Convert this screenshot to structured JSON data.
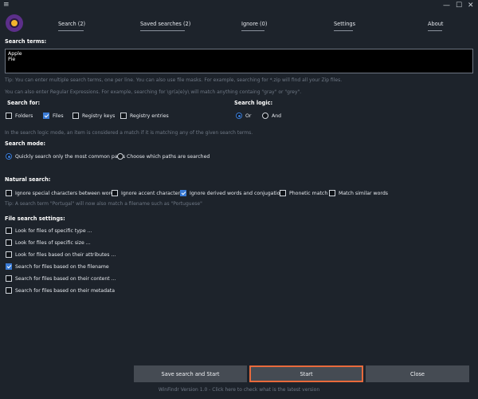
{
  "window": {
    "menu_icon": "hamburger-icon",
    "minimize": "—",
    "maximize": "☐",
    "close": "✕"
  },
  "tabs": [
    {
      "label": "Search (2)"
    },
    {
      "label": "Saved searches (2)"
    },
    {
      "label": "Ignore (0)"
    },
    {
      "label": "Settings"
    },
    {
      "label": "About"
    }
  ],
  "search_terms": {
    "label": "Search terms:",
    "value": "Apple\nPie",
    "tip1": "Tip: You can enter multiple search terms, one per line. You can also use file masks. For example, searching for *.zip will find all your Zip files.",
    "tip2": "You can also enter Regular Expressions. For example, searching for \\gr(a|e)y\\ will match anything containg \"gray\" or \"grey\"."
  },
  "search_for": {
    "label": "Search for:",
    "options": [
      {
        "label": "Folders",
        "checked": false
      },
      {
        "label": "Files",
        "checked": true
      },
      {
        "label": "Registry keys",
        "checked": false
      },
      {
        "label": "Registry entries",
        "checked": false
      }
    ]
  },
  "search_logic": {
    "label": "Search logic:",
    "options": [
      {
        "label": "Or",
        "selected": true
      },
      {
        "label": "And",
        "selected": false
      }
    ],
    "tip": "In the search logic mode, an item is considered a match if it is matching any of the given search terms."
  },
  "search_mode": {
    "label": "Search mode:",
    "options": [
      {
        "label": "Quickly search only the most common paths",
        "selected": true
      },
      {
        "label": "Choose which paths are searched",
        "selected": false
      }
    ]
  },
  "natural_search": {
    "label": "Natural search:",
    "options": [
      {
        "label": "Ignore special characters between words",
        "checked": false
      },
      {
        "label": "Ignore accent characters",
        "checked": false
      },
      {
        "label": "Ignore derived words and conjugations",
        "checked": true
      },
      {
        "label": "Phonetic match",
        "checked": false
      },
      {
        "label": "Match similar words",
        "checked": false
      }
    ],
    "tip": "Tip: A search term \"Portugal\" will now also match a filename such as \"Portuguese\""
  },
  "file_settings": {
    "label": "File search settings:",
    "options": [
      {
        "label": "Look for files of specific type ...",
        "checked": false
      },
      {
        "label": "Look for files of specific size ...",
        "checked": false
      },
      {
        "label": "Look for files based on their attributes ...",
        "checked": false
      },
      {
        "label": "Search for files based on the filename",
        "checked": true
      },
      {
        "label": "Search for files based on their content ...",
        "checked": false
      },
      {
        "label": "Search for files based on their metadata",
        "checked": false
      }
    ]
  },
  "buttons": {
    "save_start": "Save search and Start",
    "start": "Start",
    "close": "Close"
  },
  "footer": "WinFindr Version 1.0 - Click here to check what is the latest version",
  "colors": {
    "accent": "#3a7bd5",
    "highlight": "#e86a3c",
    "background": "#1d232b"
  }
}
